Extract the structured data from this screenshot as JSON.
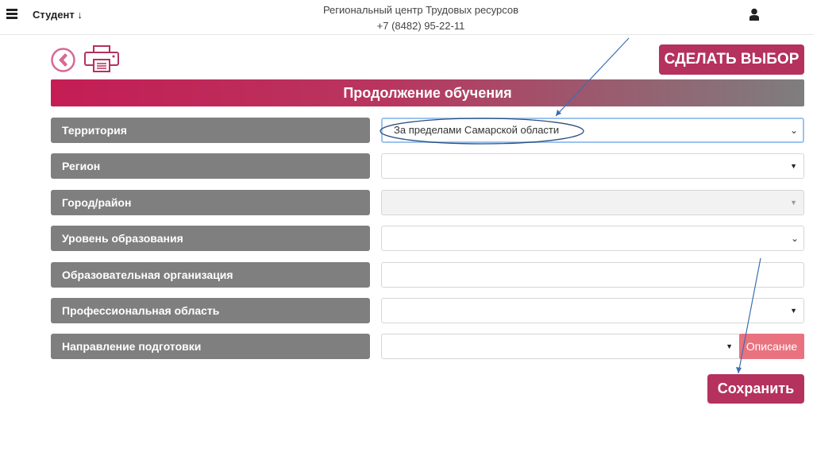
{
  "header": {
    "role": "Студент",
    "org": "Региональный центр Трудовых ресурсов",
    "phone": "+7 (8482) 95-22-11"
  },
  "toolbar": {
    "choose_label": "СДЕЛАТЬ ВЫБОР"
  },
  "section_title": "Продолжение обучения",
  "fields": [
    {
      "label": "Территория",
      "value": "За пределами Самарской области"
    },
    {
      "label": "Регион",
      "value": ""
    },
    {
      "label": "Город/район",
      "value": ""
    },
    {
      "label": "Уровень образования",
      "value": ""
    },
    {
      "label": "Образовательная организация",
      "value": ""
    },
    {
      "label": "Профессиональная область",
      "value": ""
    },
    {
      "label": "Направление подготовки",
      "value": ""
    }
  ],
  "description_label": "Описание",
  "save_label": "Сохранить",
  "colors": {
    "accent": "#b5315e",
    "label_bg": "#7f7f7f",
    "annotation": "#3a6fb0"
  }
}
